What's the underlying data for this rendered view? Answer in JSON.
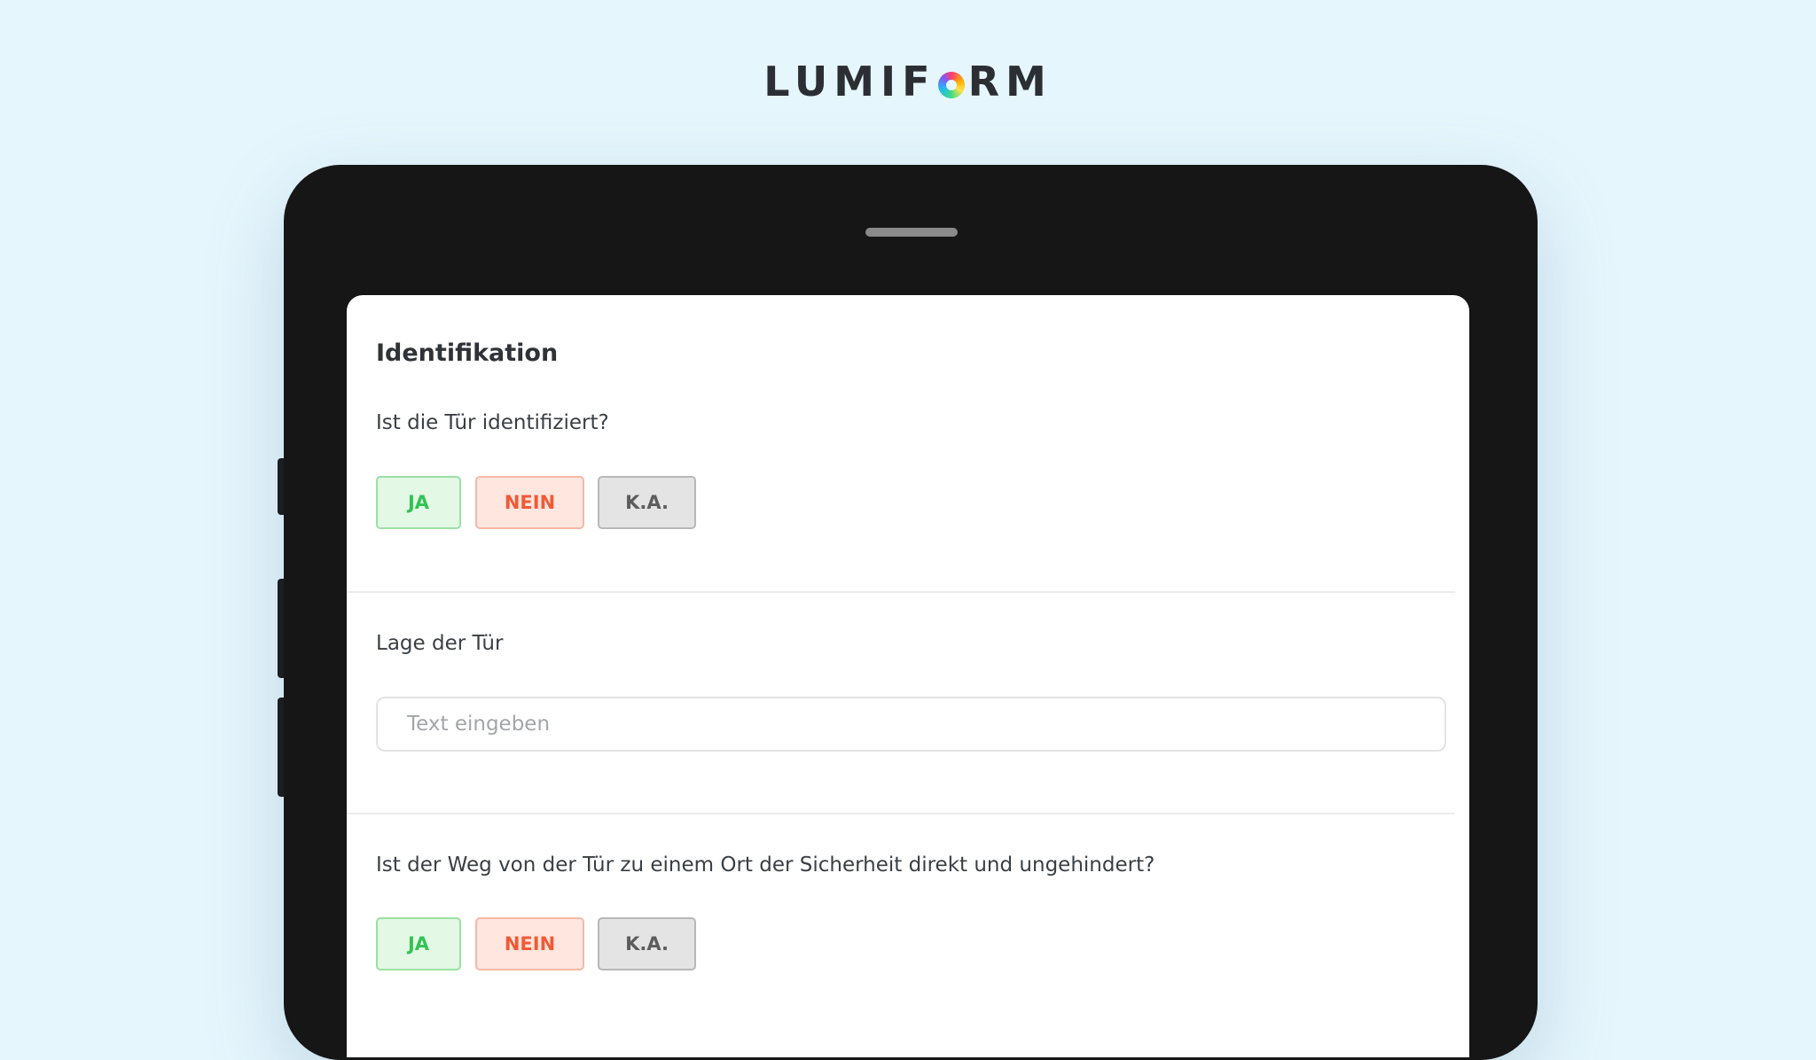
{
  "brand": {
    "logo_left": "LUMIF",
    "logo_right": "RM",
    "logo_ring_icon": "color-ring-icon"
  },
  "form": {
    "section_title": "Identifikation",
    "questions": [
      {
        "label": "Ist die Tür identifiziert?",
        "options": [
          "JA",
          "NEIN",
          "K.A."
        ]
      },
      {
        "label": "Lage der Tür",
        "input_placeholder": "Text eingeben",
        "input_value": ""
      },
      {
        "label": "Ist der Weg von der Tür zu einem Ort der Sicherheit direkt und ungehindert?",
        "options": [
          "JA",
          "NEIN",
          "K.A."
        ]
      }
    ]
  },
  "colors": {
    "background": "#e6f6fd",
    "tablet_frame": "#161616",
    "ja_text": "#33c255",
    "ja_bg": "#e3f8e5",
    "nein_text": "#f05a35",
    "nein_bg": "#ffe6df",
    "ka_text": "#5d5d5d",
    "ka_bg": "#e4e4e4"
  }
}
